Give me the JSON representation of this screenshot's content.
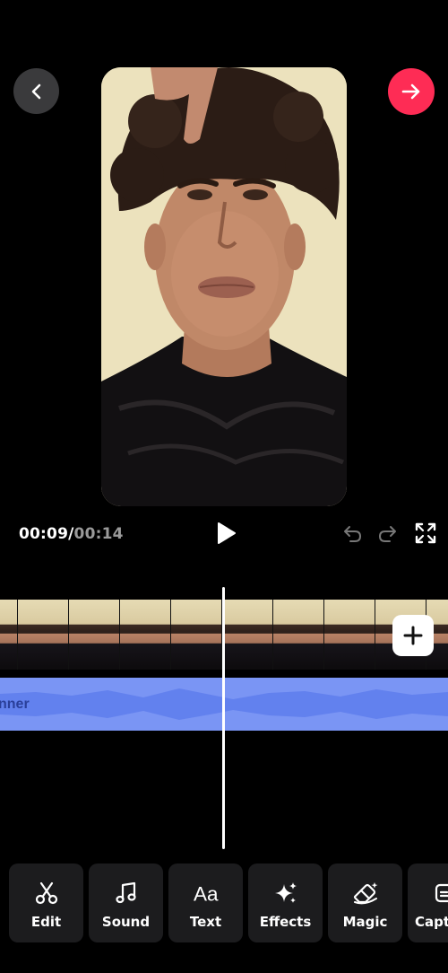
{
  "header": {
    "back_icon": "chevron-left-icon",
    "next_icon": "arrow-right-icon",
    "next_color": "#fe2c55"
  },
  "playback": {
    "current_time": "00:09",
    "separator": "/",
    "total_time": "00:14"
  },
  "timeline": {
    "audio_label": "nner",
    "audio_color": "#7a95f4"
  },
  "toolbar": {
    "items": [
      {
        "label": "Edit",
        "icon": "scissors-icon"
      },
      {
        "label": "Sound",
        "icon": "music-note-icon"
      },
      {
        "label": "Text",
        "icon": "text-aa-icon"
      },
      {
        "label": "Effects",
        "icon": "sparkles-icon"
      },
      {
        "label": "Magic",
        "icon": "magic-eraser-icon"
      },
      {
        "label": "Capt",
        "icon": "captions-icon"
      }
    ]
  }
}
